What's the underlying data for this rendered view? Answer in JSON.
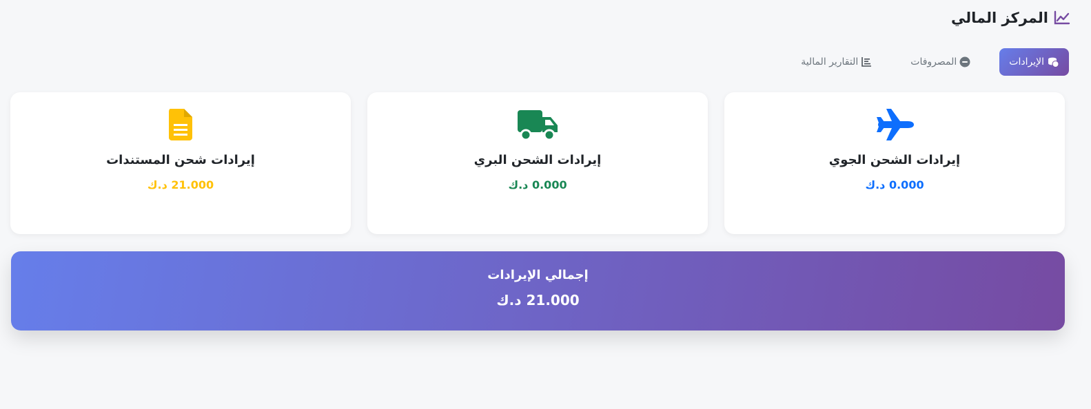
{
  "header": {
    "title": "المركز المالي",
    "icon": "chart-line-icon"
  },
  "tabs": [
    {
      "label": "الإيرادات",
      "icon": "coins-icon",
      "active": true
    },
    {
      "label": "المصروفات",
      "icon": "minus-circle-icon",
      "active": false
    },
    {
      "label": "التقارير المالية",
      "icon": "list-report-icon",
      "active": false
    }
  ],
  "cards": [
    {
      "label": "إيرادات الشحن الجوي",
      "value": "0.000 د.ك",
      "icon": "plane-icon",
      "color": "#0d6efd"
    },
    {
      "label": "إيرادات الشحن البري",
      "value": "0.000 د.ك",
      "icon": "truck-icon",
      "color": "#198754"
    },
    {
      "label": "إيرادات شحن المستندات",
      "value": "21.000 د.ك",
      "icon": "document-icon",
      "color": "#ffc107"
    }
  ],
  "total": {
    "label": "إجمالي الإيرادات",
    "value": "21.000 د.ك"
  },
  "colors": {
    "accent_start": "#667eea",
    "accent_end": "#764ba2",
    "background": "#f6f7f9"
  }
}
